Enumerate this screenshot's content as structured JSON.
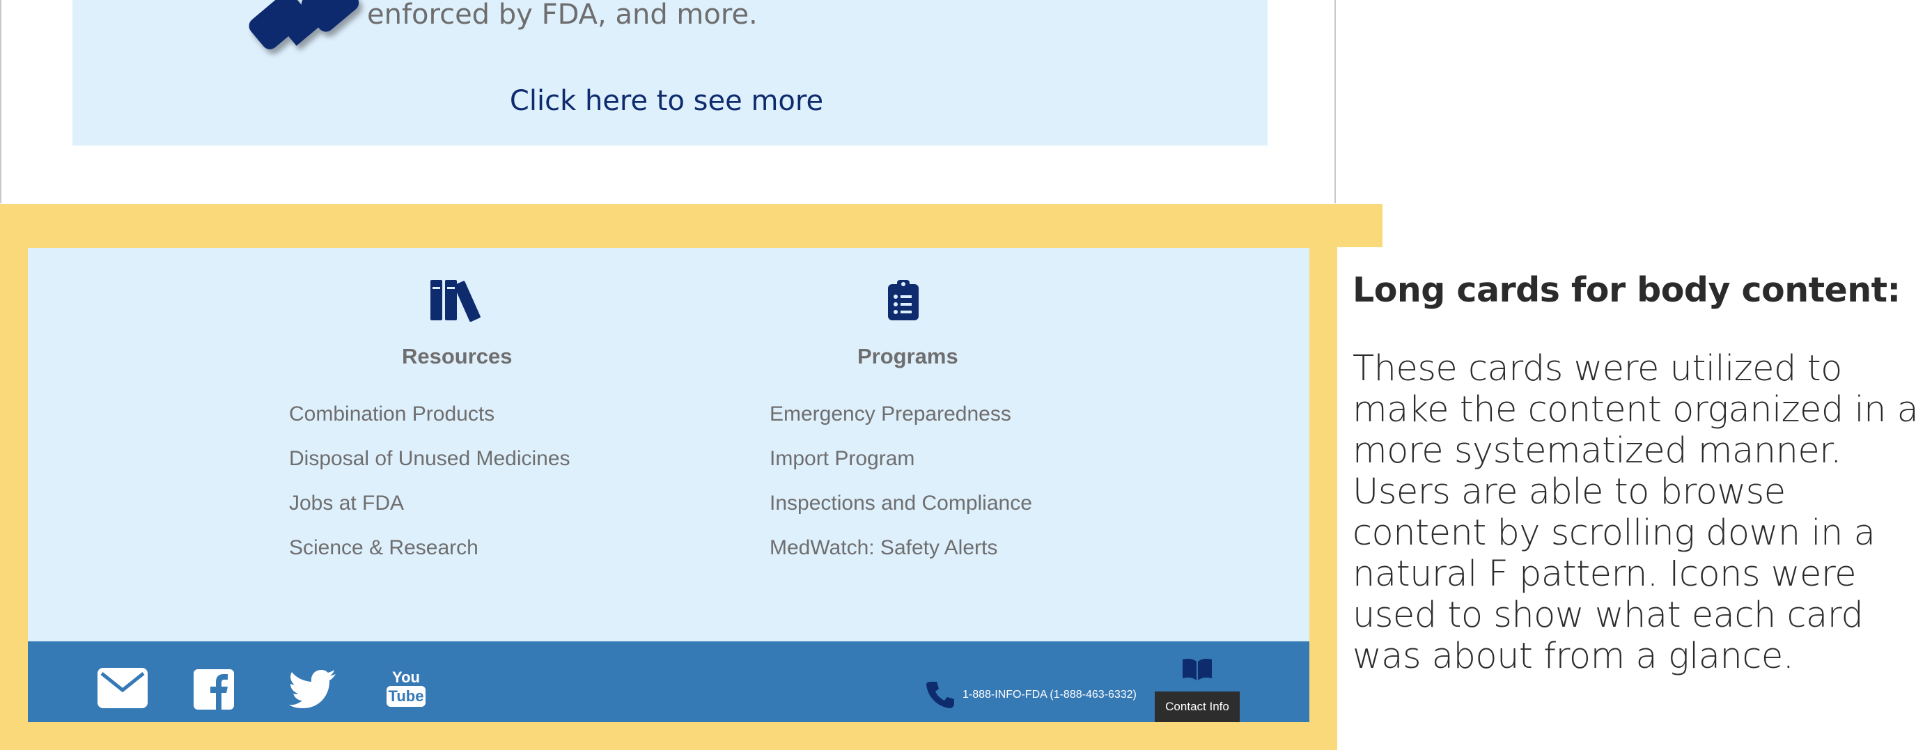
{
  "top_card": {
    "text": "enforced by FDA, and more.",
    "link": "Click here to see more"
  },
  "footer": {
    "columns": [
      {
        "icon": "books-icon",
        "heading": "Resources",
        "links": [
          "Combination Products",
          "Disposal of Unused Medicines",
          "Jobs at FDA",
          "Science & Research"
        ]
      },
      {
        "icon": "clipboard-list-icon",
        "heading": "Programs",
        "links": [
          "Emergency Preparedness",
          "Import Program",
          "Inspections and Compliance",
          "MedWatch: Safety Alerts"
        ]
      }
    ],
    "social": [
      "email-icon",
      "facebook-icon",
      "twitter-icon",
      "youtube-icon"
    ],
    "youtube_label_top": "You",
    "youtube_label_bottom": "Tube",
    "phone": "1-888-INFO-FDA (1-888-463-6332)",
    "contact_button": "Contact Info"
  },
  "annotation": {
    "title": "Long cards for body content:",
    "body": "These cards were utilized to make the content organized in a more systematized manner. Users are able to browse content by scrolling down in a natural F pattern. Icons were used to show what each card was about from a glance."
  },
  "colors": {
    "highlight": "#fad97a",
    "card_bg": "#dff0fd",
    "footer_bar": "#3579b5",
    "brand_navy": "#0e2b6e"
  }
}
